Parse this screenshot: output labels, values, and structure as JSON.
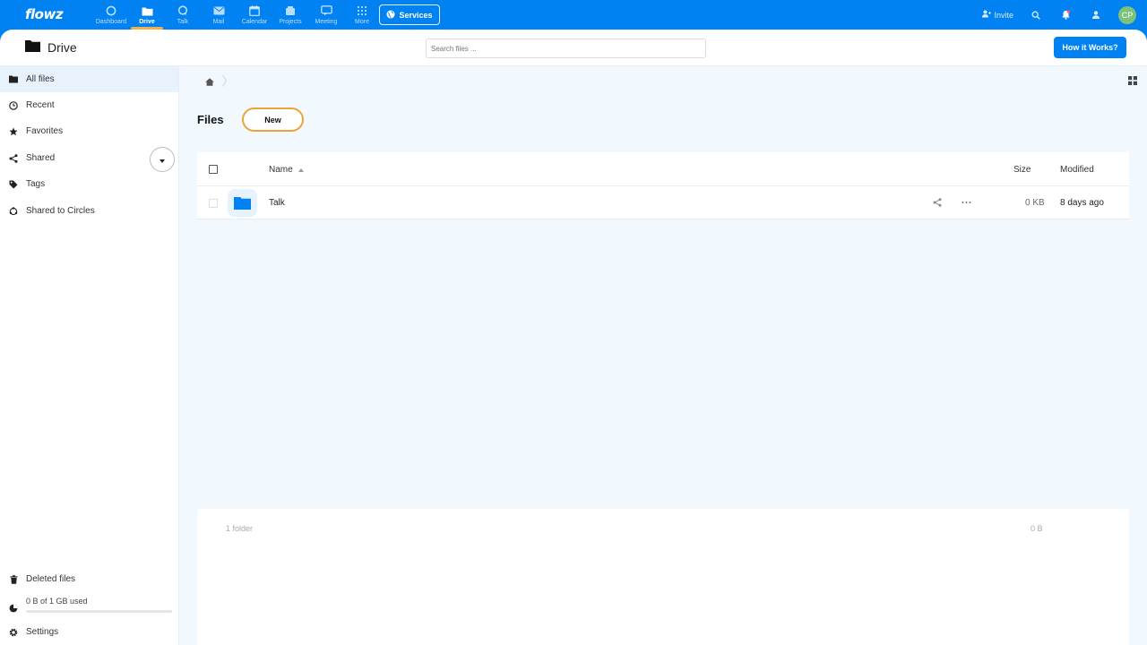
{
  "topbar": {
    "logo": "flowz",
    "apps": [
      {
        "label": "Dashboard",
        "icon": "dashboard-icon",
        "active": false
      },
      {
        "label": "Drive",
        "icon": "folder-icon",
        "active": true
      },
      {
        "label": "Talk",
        "icon": "chat-icon",
        "active": false
      },
      {
        "label": "Mail",
        "icon": "mail-icon",
        "active": false
      },
      {
        "label": "Calendar",
        "icon": "calendar-icon",
        "active": false
      },
      {
        "label": "Projects",
        "icon": "projects-icon",
        "active": false
      },
      {
        "label": "Meeting",
        "icon": "meeting-icon",
        "active": false
      },
      {
        "label": "More",
        "icon": "grid-icon",
        "active": false
      }
    ],
    "services_label": "Services",
    "invite_label": "Invite",
    "avatar_initials": "CP"
  },
  "header": {
    "title": "Drive",
    "search_placeholder": "Search files ...",
    "how_it_works_label": "How it Works?"
  },
  "sidebar": {
    "items": [
      {
        "label": "All files",
        "icon": "folder-icon",
        "active": true
      },
      {
        "label": "Recent",
        "icon": "clock-icon",
        "active": false
      },
      {
        "label": "Favorites",
        "icon": "star-icon",
        "active": false
      },
      {
        "label": "Shared",
        "icon": "share-icon",
        "active": false
      },
      {
        "label": "Tags",
        "icon": "tag-icon",
        "active": false
      },
      {
        "label": "Shared to Circles",
        "icon": "circles-icon",
        "active": false
      }
    ],
    "deleted_label": "Deleted files",
    "quota_label": "0 B of 1 GB used",
    "quota_fraction": 0,
    "settings_label": "Settings"
  },
  "main": {
    "title": "Files",
    "new_label": "New",
    "columns": {
      "name": "Name",
      "size": "Size",
      "modified": "Modified"
    },
    "rows": [
      {
        "name": "Talk",
        "size": "0 KB",
        "modified": "8 days ago",
        "type": "folder"
      }
    ],
    "summary": {
      "count": "1 folder",
      "total": "0 B"
    }
  },
  "colors": {
    "brand": "#0082f3",
    "accent": "#e9a53a",
    "active_tab_underline": "#f0b04c"
  }
}
